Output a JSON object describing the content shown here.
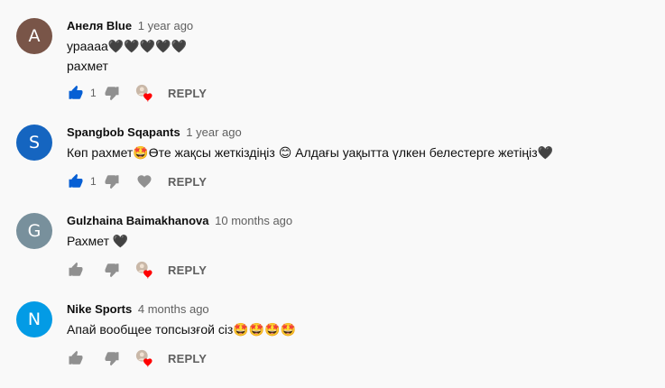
{
  "colors": {
    "background": "#f9f9f9",
    "author_text": "#0f0f0f",
    "meta_text": "#606060",
    "liked_blue": "#065fd4",
    "heart_red": "#ff0000"
  },
  "reply_label": "REPLY",
  "comments": [
    {
      "avatar_letter": "A",
      "avatar_color": "#795548",
      "author": "Анеля Blue",
      "time": "1 year ago",
      "lines": [
        "урaaaa🖤🖤🖤🖤🖤",
        "рахмет"
      ],
      "likes": "1",
      "liked": true,
      "creator_heart": true
    },
    {
      "avatar_letter": "S",
      "avatar_color": "#1565c0",
      "author": "Spangbob Sqapants",
      "time": "1 year ago",
      "lines": [
        "Көп рахмет🤩Өте жақсы жеткіздіңіз 😊 Алдағы уақытта үлкен белестерге жетіңіз🖤"
      ],
      "likes": "1",
      "liked": true,
      "creator_heart": false
    },
    {
      "avatar_letter": "G",
      "avatar_color": "#78909c",
      "author": "Gulzhaina Baimakhanova",
      "time": "10 months ago",
      "lines": [
        "Рахмет 🖤"
      ],
      "likes": "",
      "liked": false,
      "creator_heart": true
    },
    {
      "avatar_letter": "N",
      "avatar_color": "#039be5",
      "author": "Nike Sports",
      "time": "4 months ago",
      "lines": [
        "Апай вообщее топсызғой сіз🤩🤩🤩🤩"
      ],
      "likes": "",
      "liked": false,
      "creator_heart": true
    }
  ]
}
